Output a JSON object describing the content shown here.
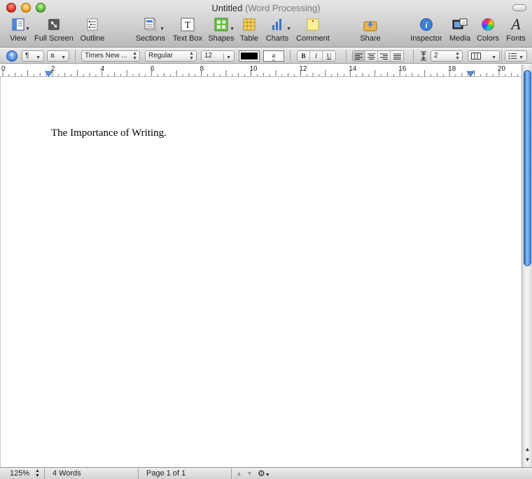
{
  "window": {
    "title": "Untitled",
    "subtitle": "(Word Processing)"
  },
  "toolbar": {
    "view": "View",
    "full_screen": "Full Screen",
    "outline": "Outline",
    "sections": "Sections",
    "text_box": "Text Box",
    "shapes": "Shapes",
    "table": "Table",
    "charts": "Charts",
    "comment": "Comment",
    "share": "Share",
    "inspector": "Inspector",
    "media": "Media",
    "colors": "Colors",
    "fonts": "Fonts"
  },
  "format_bar": {
    "paragraph_style": "¶",
    "character_style": "a",
    "font_family": "Times New ...",
    "font_typeface": "Regular",
    "font_size": "12",
    "text_color": "#000000",
    "highlight_glyph": "a",
    "bold": "B",
    "italic": "I",
    "underline": "U",
    "line_spacing": "2",
    "accent_color": "#2e6fc9"
  },
  "ruler": {
    "labels": [
      "0",
      "2",
      "4",
      "6",
      "8",
      "10",
      "12",
      "14",
      "16",
      "18",
      "20"
    ]
  },
  "document": {
    "body_text": "The Importance of Writing."
  },
  "status_bar": {
    "zoom": "125%",
    "word_count": "4 Words",
    "page_info": "Page 1 of 1"
  }
}
